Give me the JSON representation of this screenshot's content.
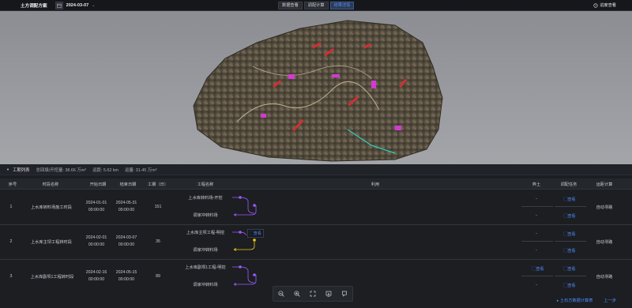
{
  "header": {
    "app_title": "土方调配方案",
    "date": "2024-03-07",
    "tabs": [
      {
        "label": "数据查看",
        "active": false
      },
      {
        "label": "调配计算",
        "active": false
      },
      {
        "label": "结果详情",
        "active": true
      }
    ],
    "progress_link": "进度查看"
  },
  "panel": {
    "title": "工期列表",
    "stats": {
      "fill_total": "总回填/开挖量: 38.66 万m³",
      "distance": "运距: 5.62 km",
      "transport": "运量: 31.45 万m³"
    }
  },
  "table": {
    "headers": [
      "序号",
      "时段名称",
      "开始日期",
      "结束日期",
      "工期（日）",
      "工程名称",
      "利用",
      "弃土",
      "调配任务",
      "运距计算"
    ],
    "rows": [
      {
        "index": "1",
        "name": "上水库转料场施工时段",
        "start_date": "2024-01-01",
        "start_time": "00:00:00",
        "end_date": "2024-05-31",
        "end_time": "00:00:00",
        "days": "151",
        "project_top": "上水库转料场-开挖",
        "project_bottom": "调家冲转料场",
        "waste": [
          "-",
          "-"
        ],
        "task": [
          "查看",
          "查看"
        ],
        "calc": "自动寻路"
      },
      {
        "index": "2",
        "name": "上水库主坝工程转时段",
        "start_date": "2024-02-01",
        "start_time": "00:00:00",
        "end_date": "2024-03-07",
        "end_time": "00:00:00",
        "days": "35",
        "project_top": "上水库主坝工程-明挖",
        "project_bottom": "调家冲转料场",
        "tooltip": "查看",
        "waste": [
          "-",
          "-"
        ],
        "task": [
          "查看",
          "查看"
        ],
        "calc": "自动寻路"
      },
      {
        "index": "3",
        "name": "上水库副坝1工程转时段",
        "start_date": "2024-02-16",
        "start_time": "00:00:00",
        "end_date": "2024-05-15",
        "end_time": "00:00:00",
        "days": "89",
        "project_top": "上水库副坝1工程-明挖",
        "project_bottom": "调家冲转料场",
        "waste": [
          "查看",
          "-"
        ],
        "task": [
          "查看",
          "查看"
        ],
        "calc": "自动寻路"
      }
    ]
  },
  "footer": {
    "table_link": "土石方数据计算表",
    "prev_link": "上一步"
  },
  "colors": {
    "accent": "#4f8dff",
    "purple": "#a259ff",
    "yellow": "#f5c518"
  }
}
